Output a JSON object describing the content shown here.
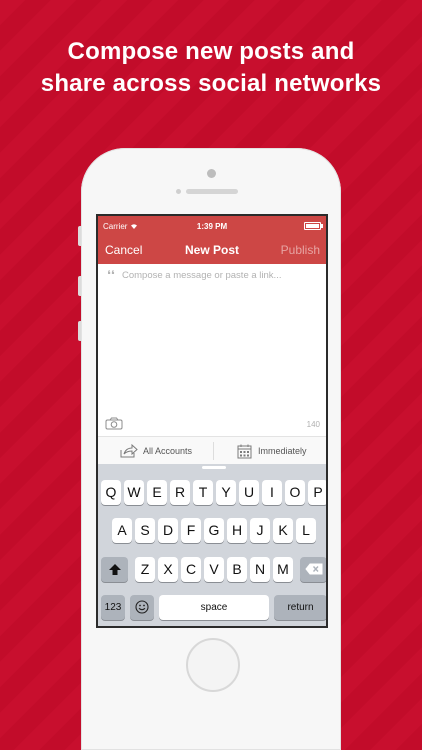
{
  "headline": {
    "line1": "Compose new posts and",
    "line2": "share across social networks"
  },
  "status_bar": {
    "carrier": "Carrier",
    "time": "1:39 PM"
  },
  "nav": {
    "cancel": "Cancel",
    "title": "New Post",
    "publish": "Publish"
  },
  "compose": {
    "placeholder": "Compose a message or paste a link...",
    "char_count": "140"
  },
  "options": {
    "accounts": "All Accounts",
    "schedule": "Immediately"
  },
  "keyboard": {
    "row1": [
      "Q",
      "W",
      "E",
      "R",
      "T",
      "Y",
      "U",
      "I",
      "O",
      "P"
    ],
    "row2": [
      "A",
      "S",
      "D",
      "F",
      "G",
      "H",
      "J",
      "K",
      "L"
    ],
    "row3": [
      "Z",
      "X",
      "C",
      "V",
      "B",
      "N",
      "M"
    ],
    "numbers": "123",
    "space": "space",
    "return": "return"
  },
  "colors": {
    "background": "#c80f2e",
    "nav_bar": "#cd4745",
    "keyboard": "#d1d5db"
  }
}
